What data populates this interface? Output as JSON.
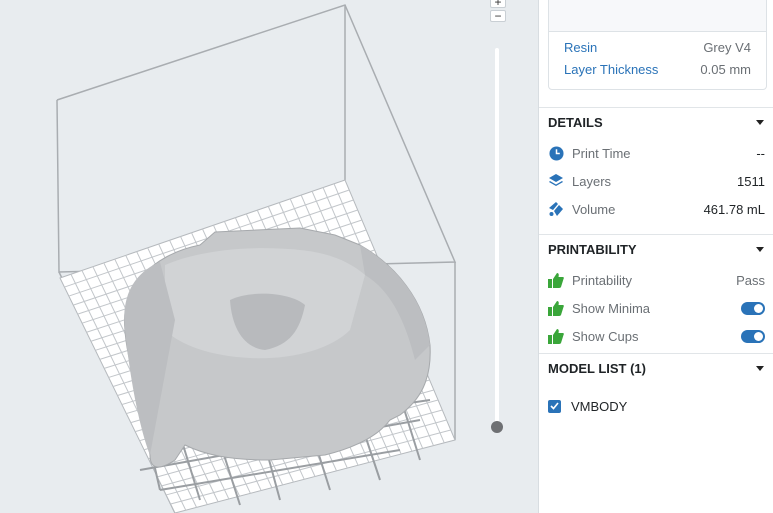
{
  "viewport": {
    "zoom_in_label": "+",
    "zoom_out_label": "−"
  },
  "material": {
    "resin_label": "Resin",
    "resin_value": "Grey V4",
    "layer_thickness_label": "Layer Thickness",
    "layer_thickness_value": "0.05 mm"
  },
  "details": {
    "title": "DETAILS",
    "print_time_label": "Print Time",
    "print_time_value": "--",
    "layers_label": "Layers",
    "layers_value": "1511",
    "volume_label": "Volume",
    "volume_value": "461.78 mL"
  },
  "printability": {
    "title": "PRINTABILITY",
    "status_label": "Printability",
    "status_value": "Pass",
    "show_minima_label": "Show Minima",
    "show_minima_on": true,
    "show_cups_label": "Show Cups",
    "show_cups_on": true
  },
  "model_list": {
    "title": "MODEL LIST (1)",
    "models": [
      {
        "name": "VMBODY",
        "checked": true
      }
    ]
  },
  "colors": {
    "accent": "#2a73b8",
    "thumbs_green": "#3aa63a"
  }
}
